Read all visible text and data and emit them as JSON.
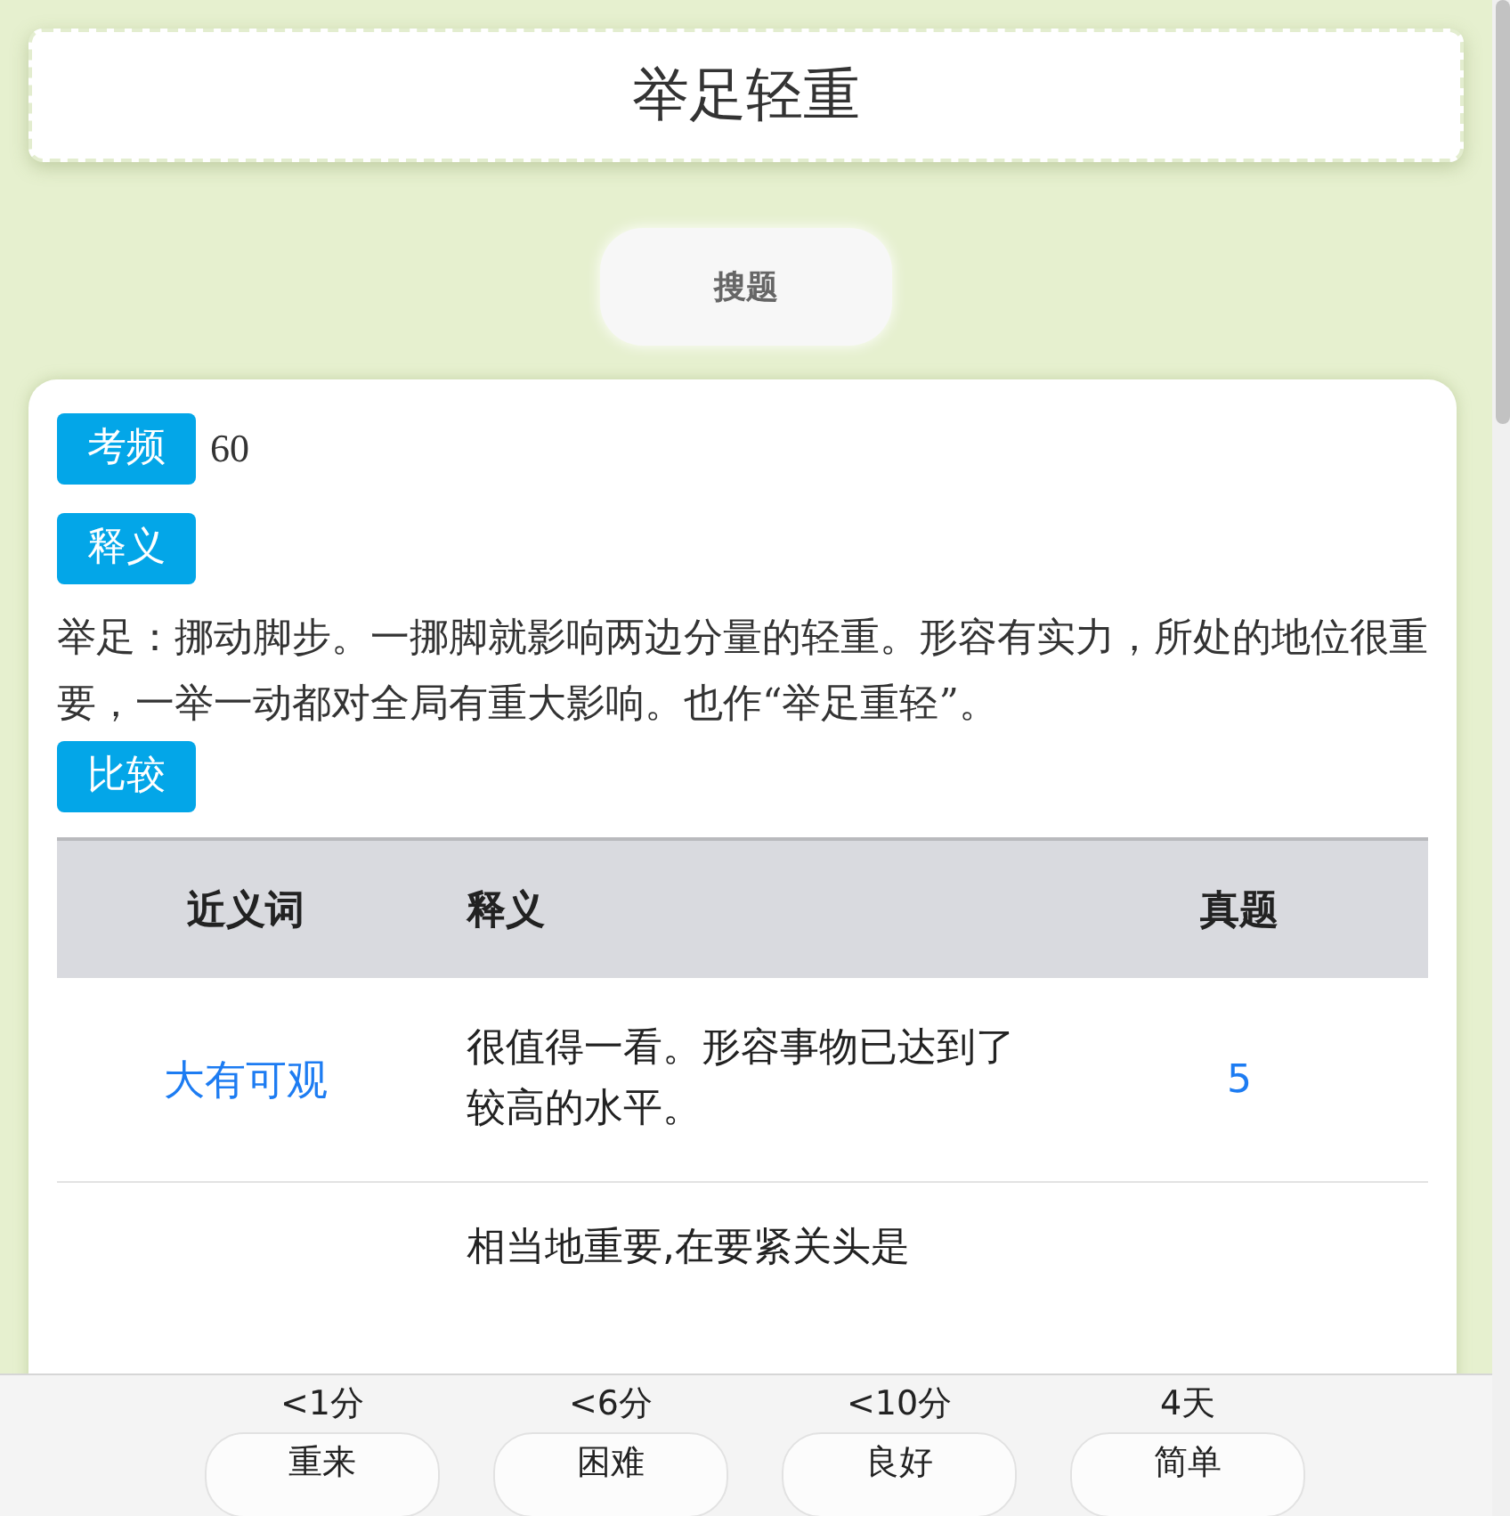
{
  "title": "举足轻重",
  "search_button": "搜题",
  "frequency": {
    "label": "考频",
    "value": "60"
  },
  "meaning": {
    "label": "释义",
    "text": "举足：挪动脚步。一挪脚就影响两边分量的轻重。形容有实力，所处的地位很重要，一举一动都对全局有重大影响。也作“举足重轻”。"
  },
  "compare": {
    "label": "比较"
  },
  "table": {
    "columns": [
      "近义词",
      "释义",
      "真题"
    ],
    "rows": [
      {
        "synonym": "大有可观",
        "meaning": "很值得一看。形容事物已达到了较高的水平。",
        "count": "5"
      },
      {
        "meaning": "相当地重要,在要紧关头是"
      }
    ]
  },
  "answers": [
    {
      "interval": "<1分",
      "label": "重来"
    },
    {
      "interval": "<6分",
      "label": "困难"
    },
    {
      "interval": "<10分",
      "label": "良好"
    },
    {
      "interval": "4天",
      "label": "简单"
    }
  ]
}
